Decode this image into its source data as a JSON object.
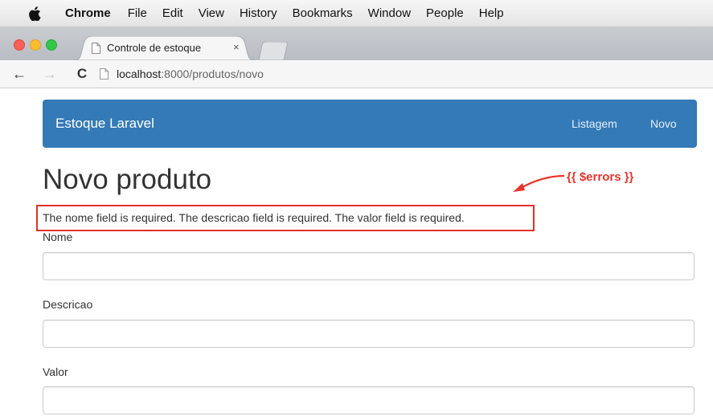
{
  "menubar": {
    "app_name": "Chrome",
    "items": [
      "File",
      "Edit",
      "View",
      "History",
      "Bookmarks",
      "Window",
      "People",
      "Help"
    ]
  },
  "browser": {
    "tab_title": "Controle de estoque",
    "tab_close": "×",
    "url_host": "localhost",
    "url_rest": ":8000/produtos/novo"
  },
  "navbar": {
    "brand": "Estoque Laravel",
    "links": [
      "Listagem",
      "Novo"
    ],
    "color": "#337ab7"
  },
  "page": {
    "title": "Novo produto",
    "errors": "The nome field is required. The descricao field is required. The valor field is required."
  },
  "annotation": {
    "label": "{{ $errors }}",
    "color": "#e8352b"
  },
  "form": {
    "nome_label": "Nome",
    "descricao_label": "Descricao",
    "valor_label": "Valor",
    "nome_value": "",
    "descricao_value": "",
    "valor_value": ""
  }
}
